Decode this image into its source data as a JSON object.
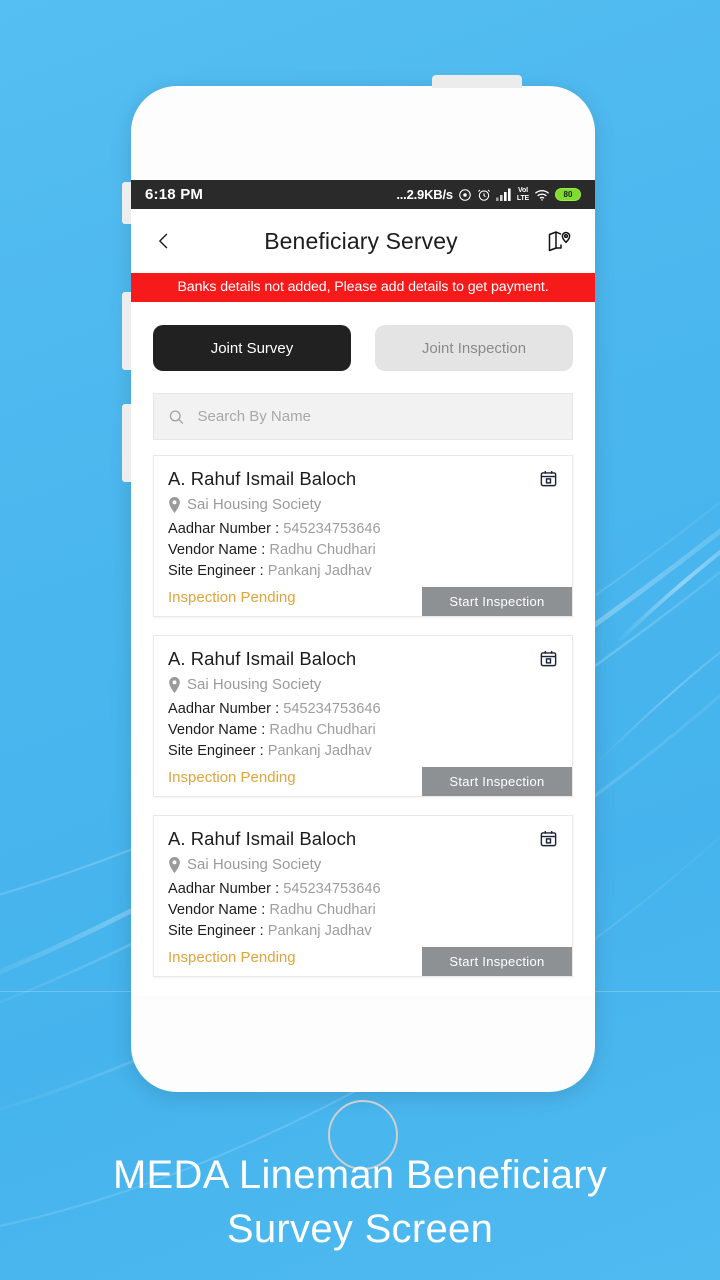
{
  "background": {
    "color": "#4cb8ef"
  },
  "caption": {
    "line1": "MEDA Lineman Beneficiary",
    "line2": "Survey Screen"
  },
  "statusbar": {
    "time": "6:18 PM",
    "network_speed": "...2.9KB/s",
    "icons": [
      "gps-icon",
      "alarm-icon",
      "signal-bars-icon",
      "volte-icon",
      "wifi-icon",
      "battery-icon"
    ],
    "volte_top": "VoI",
    "volte_bottom": "LTE",
    "battery_level": "80"
  },
  "header": {
    "title": "Beneficiary Servey",
    "back_icon": "chevron-left-icon",
    "map_icon": "map-pin-icon"
  },
  "alert": {
    "message": "Banks details not added, Please add details to get payment.",
    "color": "#f61a1a"
  },
  "tabs": [
    {
      "label": "Joint Survey",
      "active": true
    },
    {
      "label": "Joint Inspection",
      "active": false
    }
  ],
  "search": {
    "placeholder": "Search By Name",
    "value": "",
    "icon": "search-icon"
  },
  "labels": {
    "aadhar": "Aadhar Number :",
    "vendor": "Vendor Name :",
    "engineer": "Site Engineer :"
  },
  "cards": [
    {
      "name": "A. Rahuf Ismail Baloch",
      "society": "Sai Housing Society",
      "aadhar": "545234753646",
      "vendor": "Radhu Chudhari",
      "engineer": "Pankanj Jadhav",
      "status": "Inspection Pending",
      "status_color": "#e0a43c",
      "action": "Start Inspection"
    },
    {
      "name": "A. Rahuf Ismail Baloch",
      "society": "Sai Housing Society",
      "aadhar": "545234753646",
      "vendor": "Radhu Chudhari",
      "engineer": "Pankanj Jadhav",
      "status": "Inspection Pending",
      "status_color": "#e0a43c",
      "action": "Start Inspection"
    },
    {
      "name": "A. Rahuf Ismail Baloch",
      "society": "Sai Housing Society",
      "aadhar": "545234753646",
      "vendor": "Radhu Chudhari",
      "engineer": "Pankanj Jadhav",
      "status": "Inspection Pending",
      "status_color": "#e0a43c",
      "action": "Start Inspection"
    }
  ]
}
